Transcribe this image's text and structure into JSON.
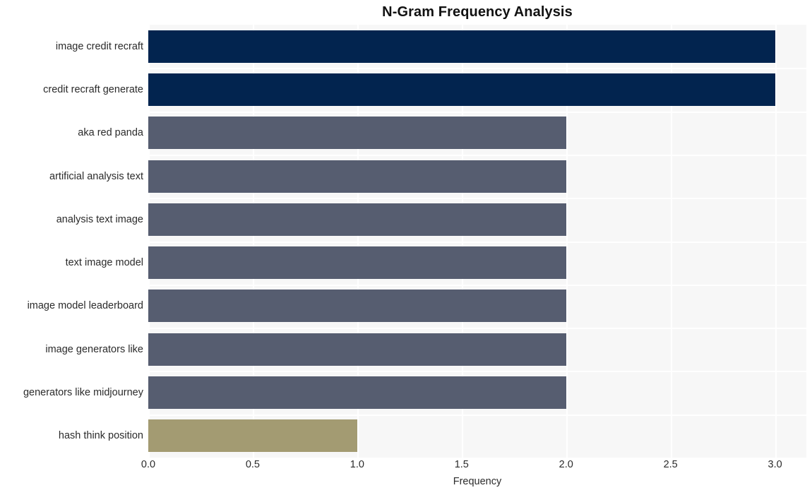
{
  "chart_data": {
    "type": "bar",
    "orientation": "horizontal",
    "title": "N-Gram Frequency Analysis",
    "xlabel": "Frequency",
    "ylabel": "",
    "xlim": [
      0,
      3.15
    ],
    "xticks": [
      "0.0",
      "0.5",
      "1.0",
      "1.5",
      "2.0",
      "2.5",
      "3.0"
    ],
    "xtick_values": [
      0,
      0.5,
      1,
      1.5,
      2,
      2.5,
      3
    ],
    "grid": true,
    "legend": "none",
    "categories": [
      "image credit recraft",
      "credit recraft generate",
      "aka red panda",
      "artificial analysis text",
      "analysis text image",
      "text image model",
      "image model leaderboard",
      "image generators like",
      "generators like midjourney",
      "hash think position"
    ],
    "values": [
      3,
      3,
      2,
      2,
      2,
      2,
      2,
      2,
      2,
      1
    ],
    "bar_colors": [
      "#02244f",
      "#02244f",
      "#565d70",
      "#565d70",
      "#565d70",
      "#565d70",
      "#565d70",
      "#565d70",
      "#565d70",
      "#a39b72"
    ]
  },
  "style": {
    "plot_background": "#f7f7f7",
    "figure_background": "#ffffff",
    "grid_color": "#ffffff",
    "text_color": "#2b2b2b",
    "title_color": "#111111"
  }
}
